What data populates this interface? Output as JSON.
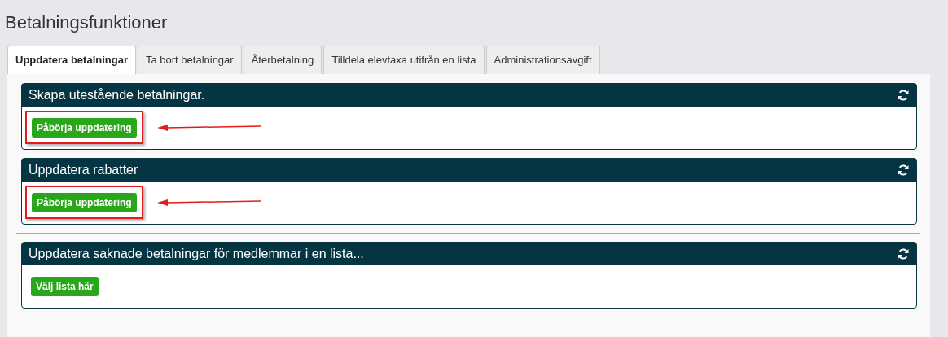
{
  "page_title": "Betalningsfunktioner",
  "tabs": [
    {
      "label": "Uppdatera betalningar",
      "selected": true
    },
    {
      "label": "Ta bort betalningar",
      "selected": false
    },
    {
      "label": "Återbetalning",
      "selected": false
    },
    {
      "label": "Tilldela elevtaxa utifrån en lista",
      "selected": false
    },
    {
      "label": "Administrationsavgift",
      "selected": false
    }
  ],
  "groups": [
    {
      "panels": [
        {
          "title": "Skapa utestående betalningar.",
          "button": "Påbörja uppdatering",
          "highlighted": true
        },
        {
          "title": "Uppdatera rabatter",
          "button": "Påbörja uppdatering",
          "highlighted": true
        }
      ]
    },
    {
      "panels": [
        {
          "title": "Uppdatera saknade betalningar för medlemmar i en lista...",
          "button": "Välj lista här",
          "highlighted": false
        }
      ]
    }
  ]
}
